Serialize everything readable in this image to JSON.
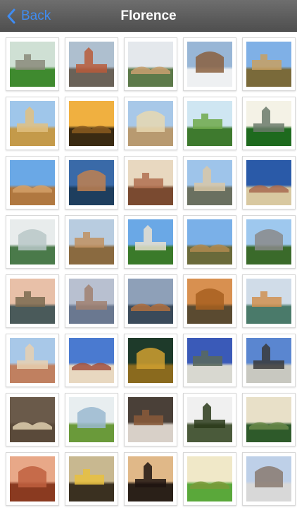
{
  "nav": {
    "back_label": "Back",
    "title": "Florence"
  },
  "colors": {
    "nav_background": "#5a5a5a",
    "back_accent": "#3f8cf2",
    "title_text": "#ffffff"
  },
  "photos": [
    {
      "subject": "fountain-statue",
      "sky": "#cfe0d4",
      "ground": "#3f8a2f",
      "accent": "#8a8a7a"
    },
    {
      "subject": "duomo-cathedral",
      "sky": "#aebfcf",
      "ground": "#6a6258",
      "accent": "#b85a3a"
    },
    {
      "subject": "arno-river",
      "sky": "#e4e8ec",
      "ground": "#5d7a4a",
      "accent": "#c9a070"
    },
    {
      "subject": "snowy-garden",
      "sky": "#98b6d6",
      "ground": "#eef0f2",
      "accent": "#8a6040"
    },
    {
      "subject": "fortress-walls",
      "sky": "#7fb0e6",
      "ground": "#7a6a3a",
      "accent": "#c8a060"
    },
    {
      "subject": "riverside-palaces",
      "sky": "#9fc6ea",
      "ground": "#c49a4a",
      "accent": "#e0c080"
    },
    {
      "subject": "sunset-skyline",
      "sky": "#f0b040",
      "ground": "#3a2a12",
      "accent": "#8a5a20"
    },
    {
      "subject": "tower-street",
      "sky": "#a8c8e8",
      "ground": "#b89a70",
      "accent": "#e8d8b0"
    },
    {
      "subject": "park-lake",
      "sky": "#cfe6f2",
      "ground": "#3e7a2e",
      "accent": "#6ea84a"
    },
    {
      "subject": "neptune-fountain",
      "sky": "#f4f2e6",
      "ground": "#1e6a1e",
      "accent": "#6a7a6a"
    },
    {
      "subject": "pitti-palace",
      "sky": "#6aa8e6",
      "ground": "#b07840",
      "accent": "#d4a068"
    },
    {
      "subject": "bridge-night",
      "sky": "#3a6aa8",
      "ground": "#1e3e5e",
      "accent": "#c08050"
    },
    {
      "subject": "arcade-colonnade",
      "sky": "#e8d8c0",
      "ground": "#7a4a30",
      "accent": "#b07050"
    },
    {
      "subject": "church-facade",
      "sky": "#9ec4ea",
      "ground": "#6a7060",
      "accent": "#d8c8a8"
    },
    {
      "subject": "giotto-campanile",
      "sky": "#2a5aa8",
      "ground": "#d8c8a0",
      "accent": "#a86a50"
    },
    {
      "subject": "glasshouse",
      "sky": "#e8ecec",
      "ground": "#4a7a4a",
      "accent": "#b8c8c8"
    },
    {
      "subject": "palazzo-vecchio",
      "sky": "#b8cce0",
      "ground": "#8a6a40",
      "accent": "#c09060"
    },
    {
      "subject": "boboli-garden",
      "sky": "#6aa8e6",
      "ground": "#3a7a2a",
      "accent": "#e8e0d0"
    },
    {
      "subject": "palace-lawn",
      "sky": "#7ab0e8",
      "ground": "#6a6a3a",
      "accent": "#b08a50"
    },
    {
      "subject": "garden-monument",
      "sky": "#9ec8ee",
      "ground": "#3a6a2a",
      "accent": "#8a8a8a"
    },
    {
      "subject": "misty-river",
      "sky": "#e8c0a8",
      "ground": "#4a5a5a",
      "accent": "#7a6a50"
    },
    {
      "subject": "ponte-vecchio-dusk",
      "sky": "#b8c0d0",
      "ground": "#6a7890",
      "accent": "#a08070"
    },
    {
      "subject": "bridge-evening",
      "sky": "#8ea0b8",
      "ground": "#3a4a5a",
      "accent": "#b07040"
    },
    {
      "subject": "autumn-avenue",
      "sky": "#d89050",
      "ground": "#5a4a30",
      "accent": "#a86020"
    },
    {
      "subject": "river-buildings",
      "sky": "#d0dce8",
      "ground": "#4a7a6a",
      "accent": "#d09050"
    },
    {
      "subject": "city-rooftops",
      "sky": "#a8c8e8",
      "ground": "#c08060",
      "accent": "#e8d0b0"
    },
    {
      "subject": "bell-tower",
      "sky": "#4a7ad0",
      "ground": "#e8d8c0",
      "accent": "#a05040"
    },
    {
      "subject": "baptistery-detail",
      "sky": "#1e3a2a",
      "ground": "#8a6a1e",
      "accent": "#d0a030"
    },
    {
      "subject": "marble-facade",
      "sky": "#3a5ab8",
      "ground": "#d8d8d0",
      "accent": "#5a6a5a"
    },
    {
      "subject": "santa-maria-novella",
      "sky": "#5a86d0",
      "ground": "#c8c8c0",
      "accent": "#3a3a3a"
    },
    {
      "subject": "church-hill",
      "sky": "#6a5a4a",
      "ground": "#5a4a3a",
      "accent": "#e0d0b0"
    },
    {
      "subject": "green-field",
      "sky": "#e8eef0",
      "ground": "#6a9a3a",
      "accent": "#9ab8d0"
    },
    {
      "subject": "bronze-sculpture",
      "sky": "#4a4038",
      "ground": "#d8d0c8",
      "accent": "#8a5a3a"
    },
    {
      "subject": "tree-lane",
      "sky": "#f0f0f0",
      "ground": "#4a5a3a",
      "accent": "#2a3a1a"
    },
    {
      "subject": "villa-garden",
      "sky": "#e8e0c8",
      "ground": "#2e5a2a",
      "accent": "#6a8a4a"
    },
    {
      "subject": "palazzo-sunset",
      "sky": "#e8a888",
      "ground": "#8a3a20",
      "accent": "#c06040"
    },
    {
      "subject": "river-clouds",
      "sky": "#c8b890",
      "ground": "#3a3020",
      "accent": "#e8c040"
    },
    {
      "subject": "bare-tree",
      "sky": "#e0b888",
      "ground": "#2a2018",
      "accent": "#1e1410"
    },
    {
      "subject": "grass-lawn",
      "sky": "#f0e8c8",
      "ground": "#5aa83a",
      "accent": "#7a9a3a"
    },
    {
      "subject": "marble-statue",
      "sky": "#bed0e8",
      "ground": "#d8d8d8",
      "accent": "#8a7a70"
    }
  ]
}
